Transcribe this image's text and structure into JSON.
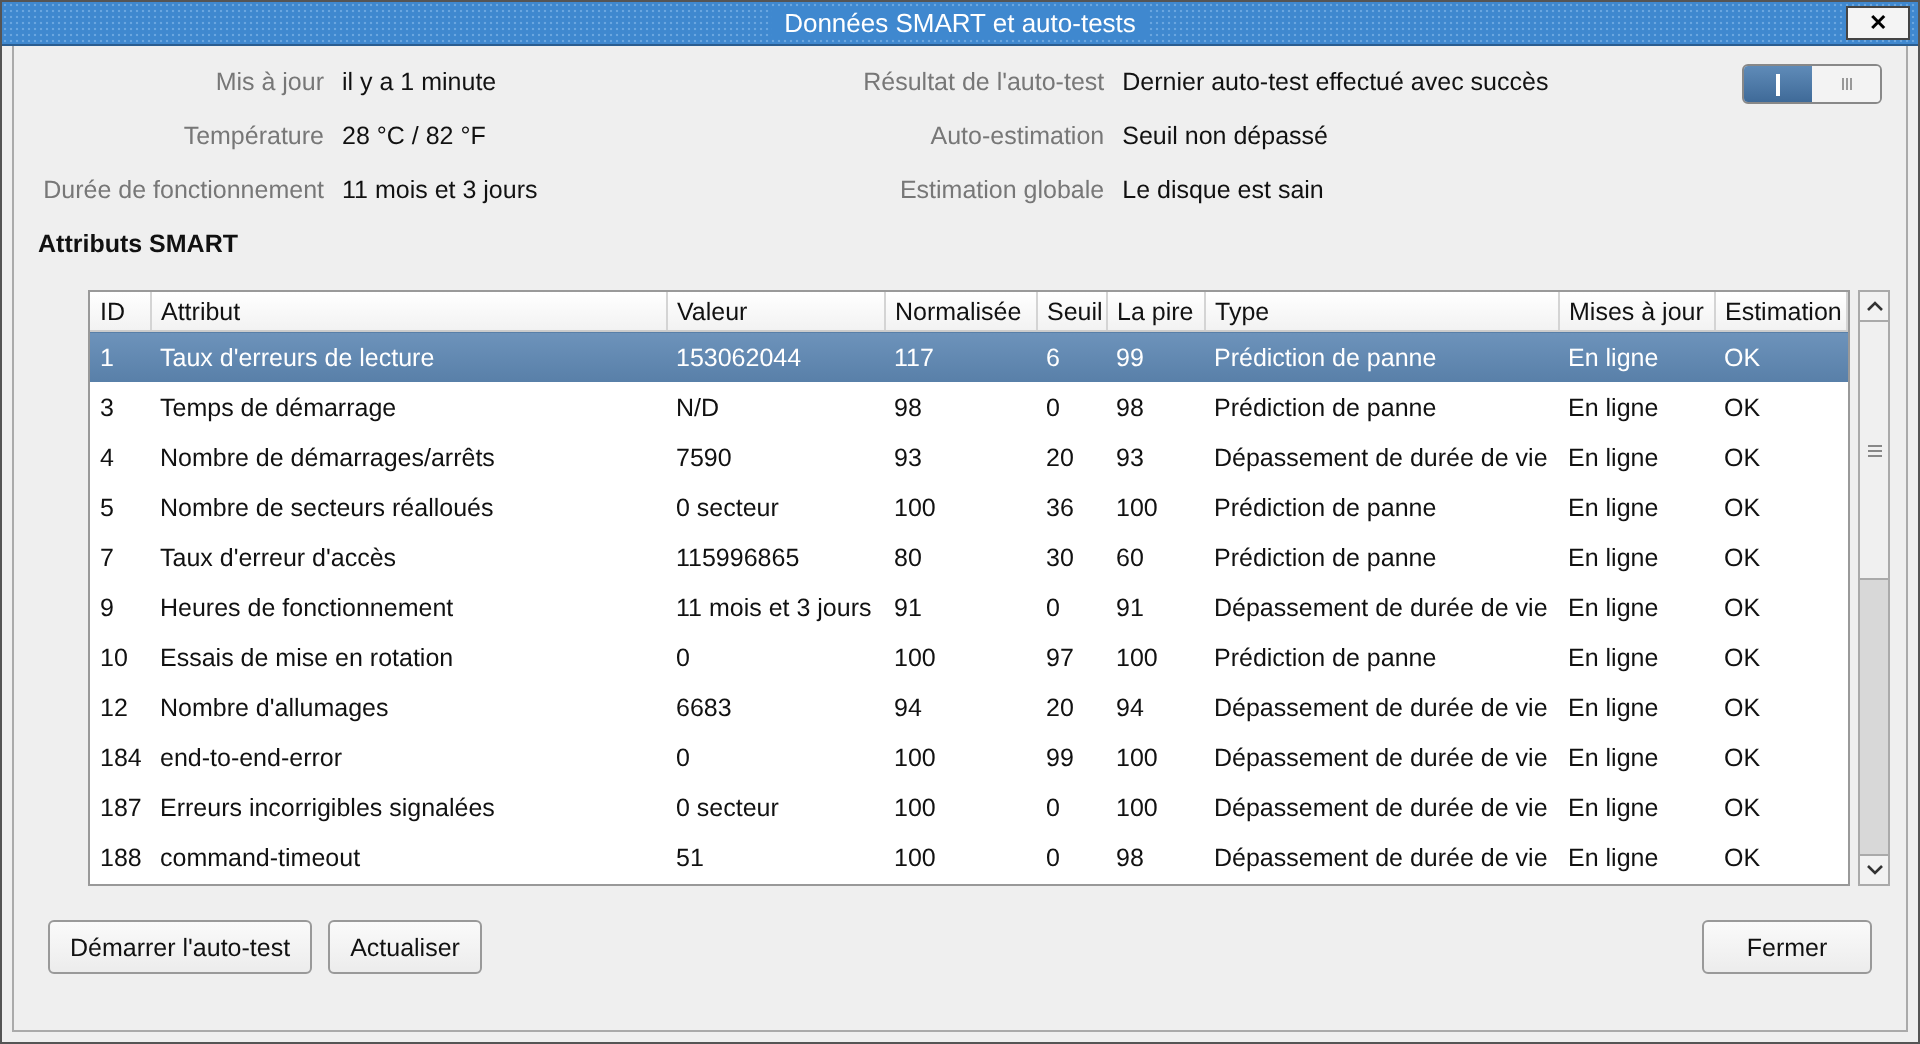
{
  "window": {
    "title": "Données SMART et auto-tests",
    "close": "✕"
  },
  "info_left": [
    {
      "label": "Mis à jour",
      "value": "il y a 1 minute"
    },
    {
      "label": "Température",
      "value": "28 °C / 82 °F"
    },
    {
      "label": "Durée de fonctionnement",
      "value": "11 mois et 3 jours"
    }
  ],
  "info_right": [
    {
      "label": "Résultat de l'auto-test",
      "value": "Dernier auto-test effectué avec succès"
    },
    {
      "label": "Auto-estimation",
      "value": "Seuil non dépassé"
    },
    {
      "label": "Estimation globale",
      "value": "Le disque est sain"
    }
  ],
  "switch": {
    "on": true
  },
  "section_title": "Attributs SMART",
  "table": {
    "columns": [
      "ID",
      "Attribut",
      "Valeur",
      "Normalisée",
      "Seuil",
      "La pire",
      "Type",
      "Mises à jour",
      "Estimation"
    ],
    "rows": [
      {
        "selected": true,
        "cells": [
          "1",
          "Taux d'erreurs de lecture",
          "153062044",
          "117",
          "6",
          "99",
          "Prédiction de panne",
          "En ligne",
          "OK"
        ]
      },
      {
        "selected": false,
        "cells": [
          "3",
          "Temps de démarrage",
          "N/D",
          "98",
          "0",
          "98",
          "Prédiction de panne",
          "En ligne",
          "OK"
        ]
      },
      {
        "selected": false,
        "cells": [
          "4",
          "Nombre de démarrages/arrêts",
          "7590",
          "93",
          "20",
          "93",
          "Dépassement de durée de vie",
          "En ligne",
          "OK"
        ]
      },
      {
        "selected": false,
        "cells": [
          "5",
          "Nombre de secteurs réalloués",
          "0 secteur",
          "100",
          "36",
          "100",
          "Prédiction de panne",
          "En ligne",
          "OK"
        ]
      },
      {
        "selected": false,
        "cells": [
          "7",
          "Taux d'erreur d'accès",
          "115996865",
          "80",
          "30",
          "60",
          "Prédiction de panne",
          "En ligne",
          "OK"
        ]
      },
      {
        "selected": false,
        "cells": [
          "9",
          "Heures de fonctionnement",
          "11 mois et 3 jours",
          "91",
          "0",
          "91",
          "Dépassement de durée de vie",
          "En ligne",
          "OK"
        ]
      },
      {
        "selected": false,
        "cells": [
          "10",
          "Essais de mise en rotation",
          "0",
          "100",
          "97",
          "100",
          "Prédiction de panne",
          "En ligne",
          "OK"
        ]
      },
      {
        "selected": false,
        "cells": [
          "12",
          "Nombre d'allumages",
          "6683",
          "94",
          "20",
          "94",
          "Dépassement de durée de vie",
          "En ligne",
          "OK"
        ]
      },
      {
        "selected": false,
        "cells": [
          "184",
          "end-to-end-error",
          "0",
          "100",
          "99",
          "100",
          "Dépassement de durée de vie",
          "En ligne",
          "OK"
        ]
      },
      {
        "selected": false,
        "cells": [
          "187",
          "Erreurs incorrigibles signalées",
          "0 secteur",
          "100",
          "0",
          "100",
          "Dépassement de durée de vie",
          "En ligne",
          "OK"
        ]
      },
      {
        "selected": false,
        "cells": [
          "188",
          "command-timeout",
          "51",
          "100",
          "0",
          "98",
          "Dépassement de durée de vie",
          "En ligne",
          "OK"
        ]
      }
    ]
  },
  "buttons_left": [
    "Démarrer l'auto-test",
    "Actualiser"
  ],
  "buttons_right": [
    "Fermer"
  ]
}
